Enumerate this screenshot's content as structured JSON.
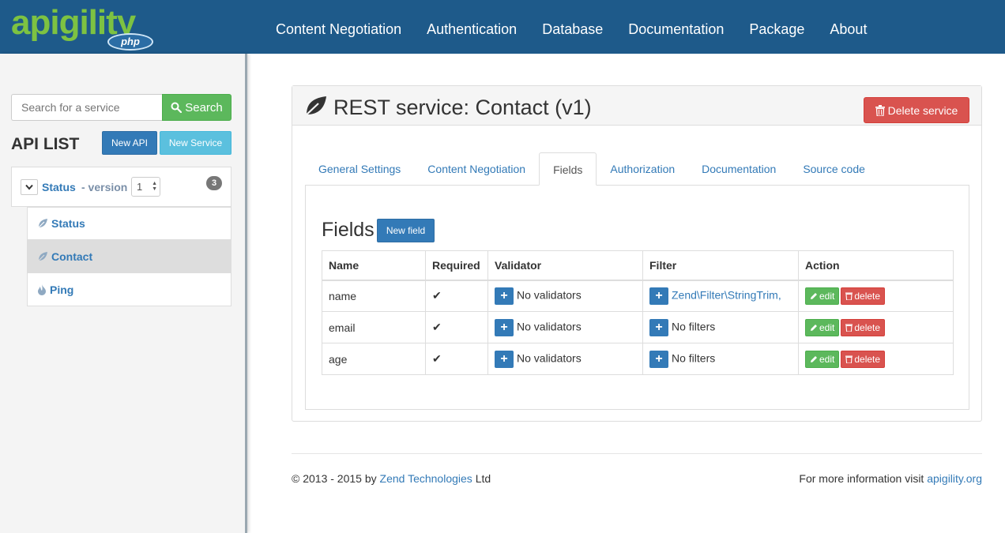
{
  "header": {
    "logo_word": "apigility",
    "logo_badge": "php",
    "nav": [
      "Content Negotiation",
      "Authentication",
      "Database",
      "Documentation",
      "Package",
      "About"
    ],
    "bg_color": "#1e5a8a",
    "logo_color": "#7dc242"
  },
  "sidebar": {
    "search_placeholder": "Search for a service",
    "search_button": "Search",
    "title": "API LIST",
    "new_api": "New API",
    "new_service": "New Service",
    "api": {
      "name": "Status",
      "version_label": "- version",
      "version_value": "1",
      "service_count": "3"
    },
    "services": [
      {
        "label": "Status",
        "icon": "leaf-icon",
        "active": false
      },
      {
        "label": "Contact",
        "icon": "leaf-icon",
        "active": true
      },
      {
        "label": "Ping",
        "icon": "fire-icon",
        "active": false
      }
    ]
  },
  "panel": {
    "title": "REST service: Contact (v1)",
    "delete_button": "Delete service",
    "tabs": [
      "General Settings",
      "Content Negotiation",
      "Fields",
      "Authorization",
      "Documentation",
      "Source code"
    ],
    "active_tab": "Fields",
    "fields_title": "Fields",
    "new_field": "New field",
    "table": {
      "headers": [
        "Name",
        "Required",
        "Validator",
        "Filter",
        "Action"
      ],
      "rows": [
        {
          "name": "name",
          "required": "✔",
          "validator": "No validators",
          "filter": "Zend\\Filter\\StringTrim,",
          "filter_is_link": true
        },
        {
          "name": "email",
          "required": "✔",
          "validator": "No validators",
          "filter": "No filters",
          "filter_is_link": false
        },
        {
          "name": "age",
          "required": "✔",
          "validator": "No validators",
          "filter": "No filters",
          "filter_is_link": false
        }
      ],
      "edit_label": "edit",
      "delete_label": "delete"
    }
  },
  "footer": {
    "copyright_prefix": "© 2013 - 2015 by",
    "company_link": "Zend Technologies",
    "copyright_suffix": "Ltd",
    "info_prefix": "For more information visit",
    "info_link": "apigility.org"
  }
}
